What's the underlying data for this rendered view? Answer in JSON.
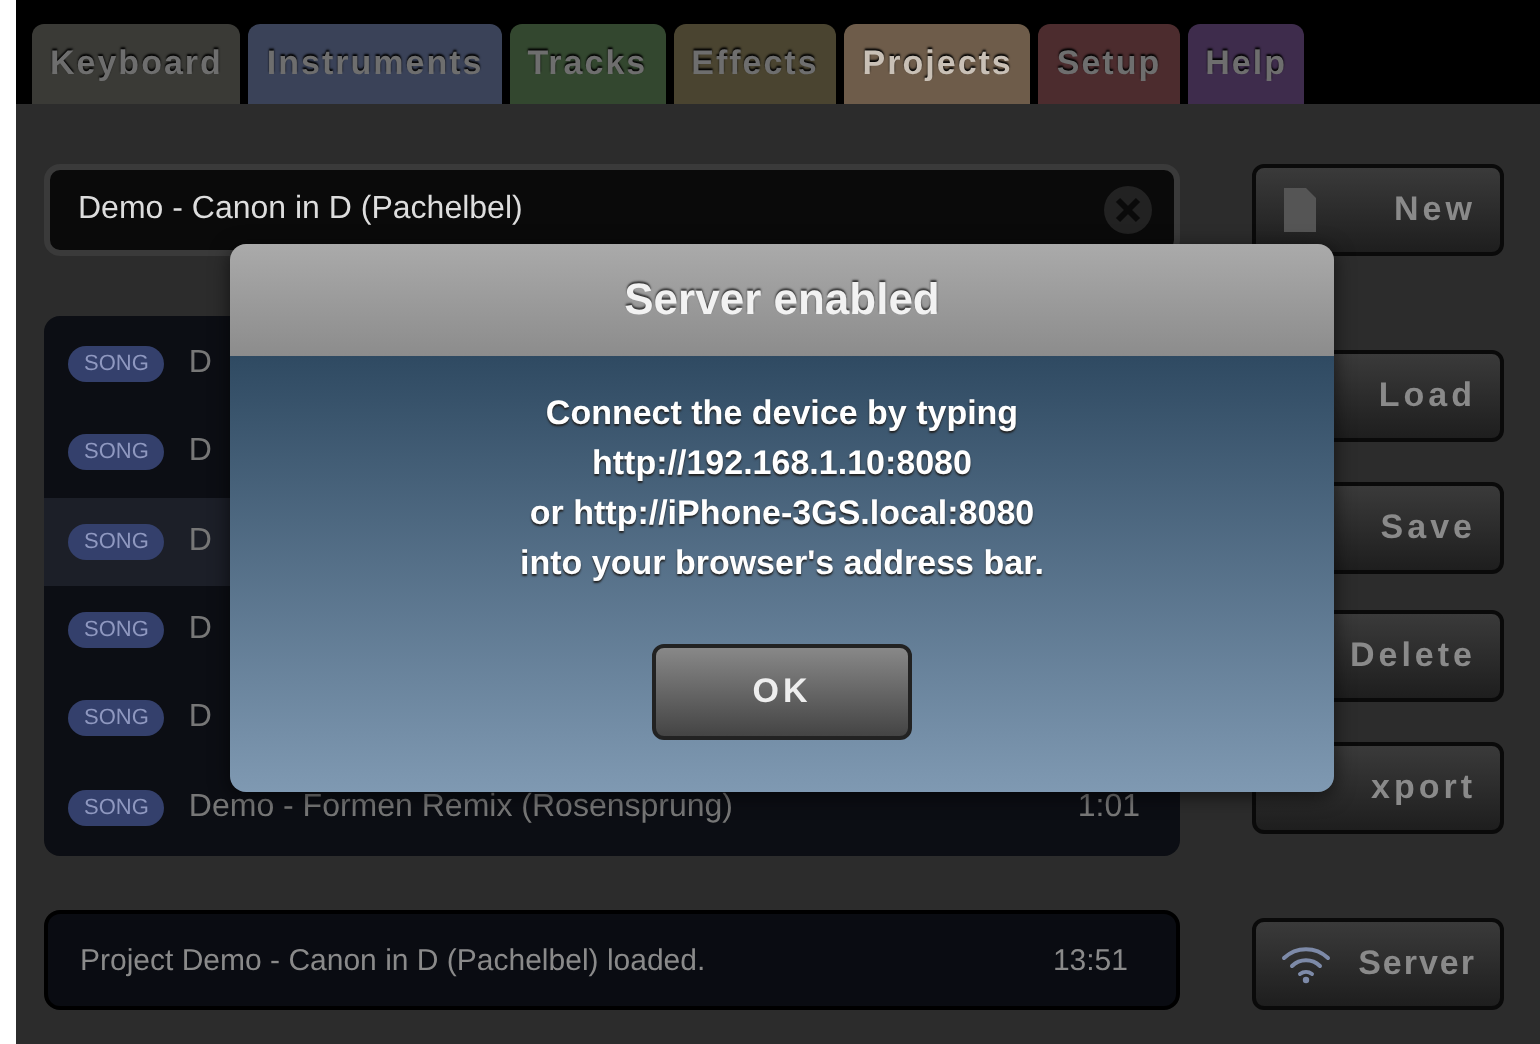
{
  "tabs": [
    {
      "label": "Keyboard",
      "selected": false,
      "color": "#3a3a36"
    },
    {
      "label": "Instruments",
      "selected": false,
      "color": "#3a4258"
    },
    {
      "label": "Tracks",
      "selected": false,
      "color": "#33472f"
    },
    {
      "label": "Effects",
      "selected": false,
      "color": "#4a4430"
    },
    {
      "label": "Projects",
      "selected": true,
      "color": "#6e5c4a"
    },
    {
      "label": "Setup",
      "selected": false,
      "color": "#4c2c2e"
    },
    {
      "label": "Help",
      "selected": false,
      "color": "#3e2c4c"
    }
  ],
  "project_field": {
    "value": "Demo - Canon in D (Pachelbel)"
  },
  "songs": [
    {
      "badge": "SONG",
      "name": "D",
      "selected": false
    },
    {
      "badge": "SONG",
      "name": "D",
      "selected": false
    },
    {
      "badge": "SONG",
      "name": "D",
      "selected": true
    },
    {
      "badge": "SONG",
      "name": "D",
      "selected": false
    },
    {
      "badge": "SONG",
      "name": "D",
      "selected": false
    },
    {
      "badge": "SONG",
      "name": "Demo - Formen Remix (Rosensprung)",
      "time": "1:01",
      "selected": false
    }
  ],
  "status_bar": {
    "message": "Project Demo - Canon in D (Pachelbel) loaded.",
    "time": "13:51"
  },
  "buttons": [
    {
      "label": "New",
      "kind": "new"
    },
    {
      "label": "Load",
      "kind": "plain"
    },
    {
      "label": "Save",
      "kind": "plain"
    },
    {
      "label": "Delete",
      "kind": "plain"
    },
    {
      "label": "xport",
      "kind": "plain"
    },
    {
      "label": "Server",
      "kind": "server"
    }
  ],
  "dialog": {
    "title": "Server enabled",
    "message": "Connect the device by typing\nhttp://192.168.1.10:8080\nor http://iPhone-3GS.local:8080\ninto your browser's address bar.",
    "button": "OK"
  }
}
